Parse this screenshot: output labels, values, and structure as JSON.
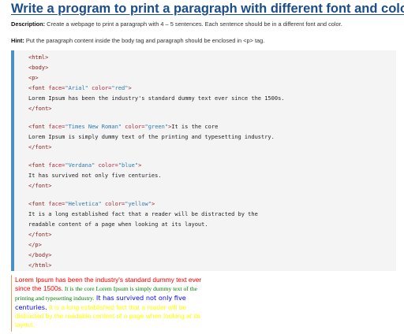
{
  "heading": "Write a program to print a paragraph with different font and color.",
  "description": {
    "label": "Description:",
    "text": " Create a webpage to print a paragraph with 4 – 5 sentences. Each sentence should be in a different font and color."
  },
  "hint": {
    "label": "Hint:",
    "text": " Put the paragraph content inside the body tag and paragraph should be enclosed in <p> tag."
  },
  "code": {
    "l_html_open": "<html>",
    "l_body_open": "<body>",
    "l_p_open": "<p>",
    "f1_open_tag": "<font ",
    "f1_face_attr": "face=",
    "f1_face_val": "\"Arial\"",
    "f1_color_attr": " color=",
    "f1_color_val": "\"red\"",
    "f1_close_bracket": ">",
    "f1_text": "Lorem Ipsum has been the industry's standard dummy text ever since the 1500s.",
    "f1_close": "</font>",
    "f2_open_tag": "<font ",
    "f2_face_attr": "face=",
    "f2_face_val": "\"Times New Roman\"",
    "f2_color_attr": " color=",
    "f2_color_val": "\"green\"",
    "f2_close_bracket": ">",
    "f2_inline_text": "It is the core",
    "f2_text": "Lorem Ipsum is simply dummy text of the printing and typesetting industry.",
    "f2_close": "</font>",
    "f3_open_tag": "<font ",
    "f3_face_attr": "face=",
    "f3_face_val": "\"Verdana\"",
    "f3_color_attr": " color=",
    "f3_color_val": "\"blue\"",
    "f3_close_bracket": ">",
    "f3_text": "It has survived not only five centuries.",
    "f3_close": "</font>",
    "f4_open_tag": "<font ",
    "f4_face_attr": "face=",
    "f4_face_val": "\"Helvetica\"",
    "f4_color_attr": " color=",
    "f4_color_val": "\"yellow\"",
    "f4_close_bracket": ">",
    "f4_text_1": "It is a long established fact that a reader will be distracted by the",
    "f4_text_2": "readable content of a page when looking at its layout.",
    "f4_close": "</font>",
    "l_p_close": "</p>",
    "l_body_close": "</body>",
    "l_html_close": "</html>"
  },
  "output": {
    "s1_line1": "Lorem Ipsum has been the industry's standard dummy text ever",
    "s1_line2": "since the 1500s.",
    "s2_line1": " It is the core Lorem Ipsum is simply dummy text of the",
    "s2_line2": "printing and typesetting industry.",
    "s3_line1": " It has survived not only five",
    "s3_line2": "centuries.",
    "s4_line1": " It is a long established fact that a reader will be",
    "s4_line2": "distracted by the readable content of a page when looking at its",
    "s4_line3": "layout."
  },
  "colors": {
    "heading": "#1a4d8c",
    "code_accent_bar": "#4a90c4",
    "out_red": "#ff0000",
    "out_green": "#008000",
    "out_blue": "#0000ff",
    "out_yellow": "#ffff00"
  }
}
